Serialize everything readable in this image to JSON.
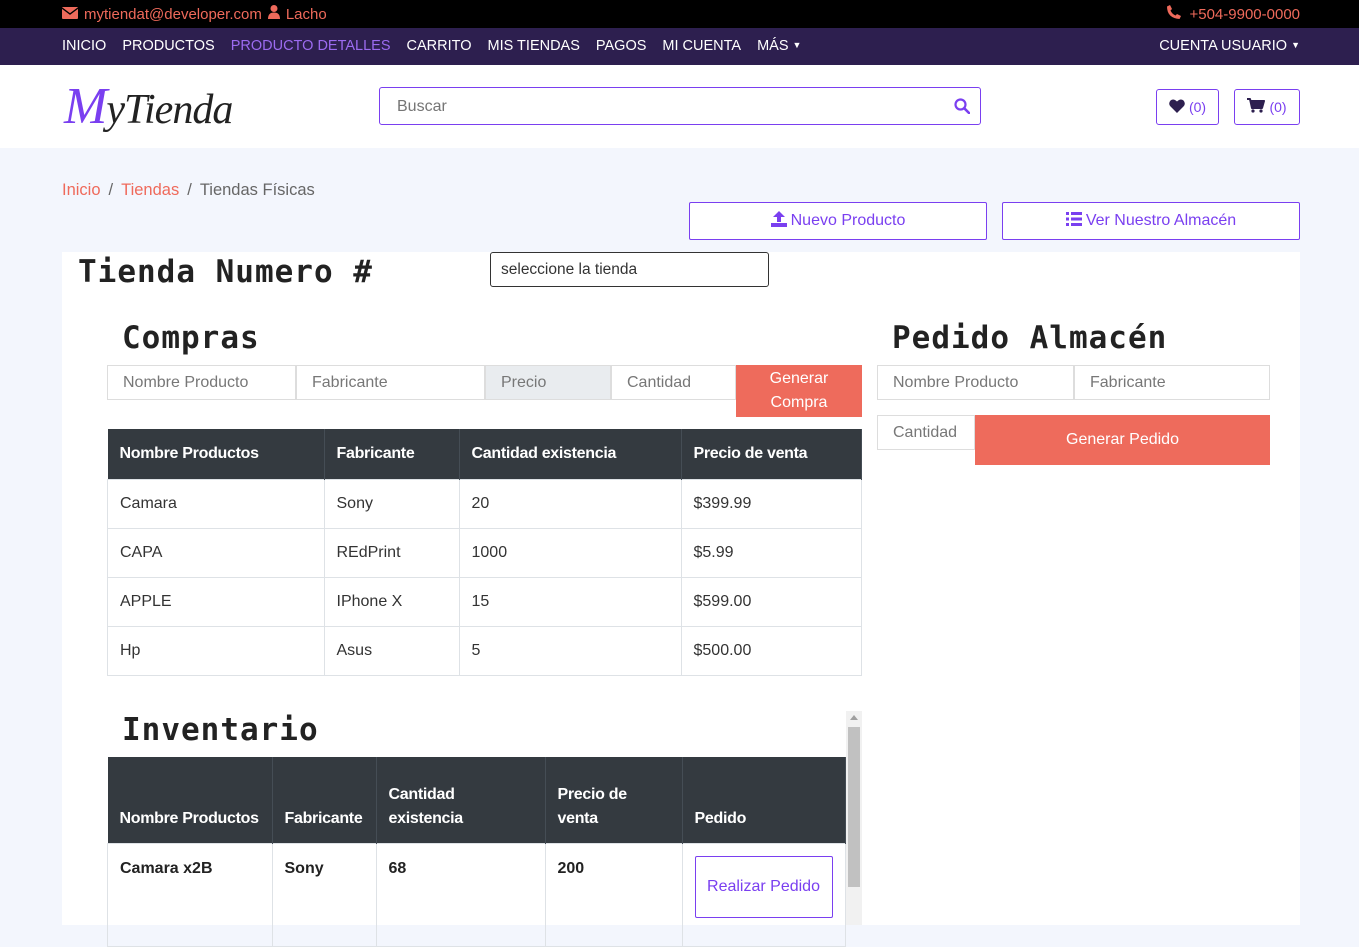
{
  "topbar": {
    "email": "mytiendat@developer.com",
    "user": "Lacho",
    "phone": "+504-9900-0000"
  },
  "nav": {
    "items": [
      "INICIO",
      "PRODUCTOS",
      "PRODUCTO DETALLES",
      "CARRITO",
      "MIS TIENDAS",
      "PAGOS",
      "MI CUENTA",
      "MÁS"
    ],
    "account": "CUENTA USUARIO"
  },
  "header": {
    "logo_m": "M",
    "logo_rest": "yTienda",
    "search_placeholder": "Buscar",
    "wishlist_count": "(0)",
    "cart_count": "(0)"
  },
  "breadcrumb": {
    "home": "Inicio",
    "stores": "Tiendas",
    "current": "Tiendas Físicas"
  },
  "actions": {
    "new_product": "Nuevo Producto",
    "warehouse": "Ver Nuestro Almacén"
  },
  "store": {
    "title": "Tienda Numero #",
    "select": "seleccione la tienda"
  },
  "compras": {
    "title": "Compras",
    "fields": {
      "name": "Nombre Producto",
      "maker": "Fabricante",
      "price": "Precio",
      "qty": "Cantidad"
    },
    "button": "Generar Compra",
    "headers": [
      "Nombre Productos",
      "Fabricante",
      "Cantidad existencia",
      "Precio de venta"
    ],
    "rows": [
      [
        "Camara",
        "Sony",
        "20",
        "$399.99"
      ],
      [
        "CAPA",
        "REdPrint",
        "1000",
        "$5.99"
      ],
      [
        "APPLE",
        "IPhone X",
        "15",
        "$599.00"
      ],
      [
        "Hp",
        "Asus",
        "5",
        "$500.00"
      ]
    ]
  },
  "pedido": {
    "title": "Pedido Almacén",
    "fields": {
      "name": "Nombre Producto",
      "maker": "Fabricante",
      "qty": "Cantidad"
    },
    "button": "Generar Pedido"
  },
  "inventario": {
    "title": "Inventario",
    "headers": [
      "Nombre Productos",
      "Fabricante",
      "Cantidad existencia",
      "Precio de venta",
      "Pedido"
    ],
    "rows": [
      {
        "name": "Camara x2B",
        "maker": "Sony",
        "qty": "68",
        "price": "200",
        "action": "Realizar Pedido"
      }
    ]
  },
  "colors": {
    "accent": "#7a3ff0",
    "coral": "#ee6b5c",
    "nav_bg": "#2d1f4f",
    "table_head": "#343a40"
  }
}
